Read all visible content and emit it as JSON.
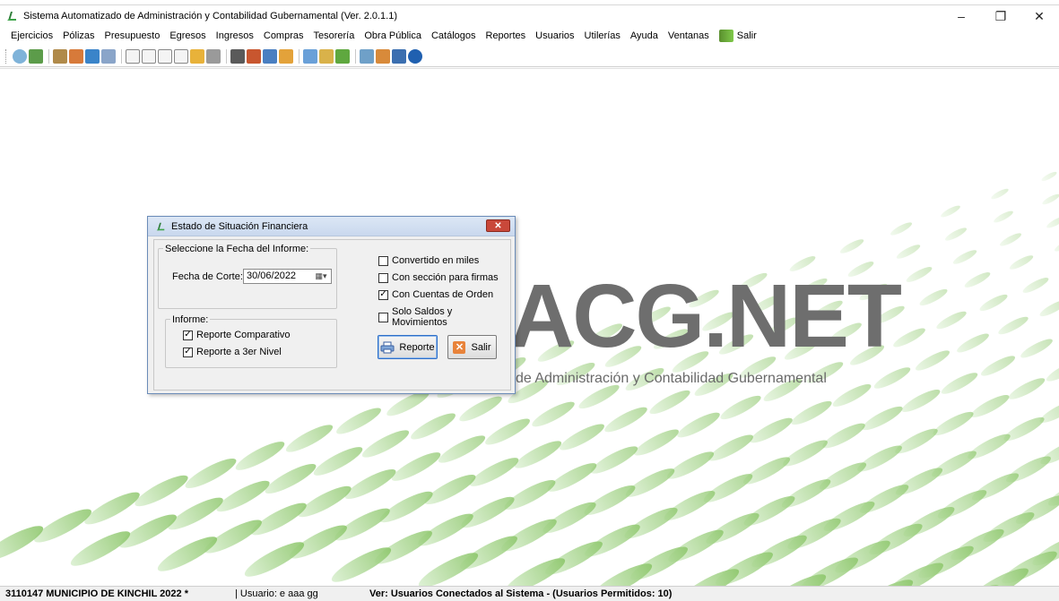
{
  "window": {
    "title": "Sistema Automatizado de Administración y Contabilidad Gubernamental  (Ver. 2.0.1.1)",
    "minimize_glyph": "–",
    "restore_glyph": "❐",
    "close_glyph": "✕"
  },
  "menubar": {
    "items": [
      "Ejercicios",
      "Pólizas",
      "Presupuesto",
      "Egresos",
      "Ingresos",
      "Compras",
      "Tesorería",
      "Obra Pública",
      "Catálogos",
      "Reportes",
      "Usuarios",
      "Utilerías",
      "Ayuda",
      "Ventanas",
      "Salir"
    ]
  },
  "toolbar": {
    "icons": [
      "refresh-icon",
      "ledger-icon",
      "printer-icon",
      "transfer-icon",
      "checklist-icon",
      "grid-icon",
      "c-icon",
      "d-icon",
      "e-icon",
      "p-icon",
      "badge-icon",
      "print-icon",
      "clipboard-icon",
      "chart-icon",
      "database-icon",
      "box-icon",
      "notes-icon",
      "tools-icon",
      "users-icon",
      "tree-icon",
      "settings-icon",
      "save-icon",
      "help-icon"
    ]
  },
  "background": {
    "logo_text": "ACG.NET",
    "logo_subtitle": "de Administración y Contabilidad Gubernamental"
  },
  "dialog": {
    "title": "Estado de Situación Financiera",
    "close_label": "✕",
    "date_group_label": "Seleccione la Fecha del Informe:",
    "date_label": "Fecha de Corte:",
    "date_value": "30/06/2022",
    "calendar_glyph": "▦▾",
    "informe_group_label": "Informe:",
    "options": [
      {
        "label": "Convertido en miles",
        "checked": false
      },
      {
        "label": "Con sección para firmas",
        "checked": false
      },
      {
        "label": "Con Cuentas de Orden",
        "checked": true
      },
      {
        "label": "Solo Saldos y Movimientos",
        "checked": false
      }
    ],
    "informe_options": [
      {
        "label": "Reporte Comparativo",
        "checked": true
      },
      {
        "label": "Reporte a 3er Nivel",
        "checked": true
      }
    ],
    "report_button": "Reporte",
    "exit_button": "Salir"
  },
  "statusbar": {
    "org": "3110147 MUNICIPIO DE KINCHIL  2022  *",
    "user": "| Usuario: e aaa gg",
    "connected": "Ver: Usuarios Conectados al Sistema  - (Usuarios Permitidos: 10)"
  },
  "colors": {
    "accent_green": "#3da44a",
    "logo_gray": "#6e6e6e",
    "dialog_border": "#6b8cb8",
    "close_red": "#c9483a"
  }
}
